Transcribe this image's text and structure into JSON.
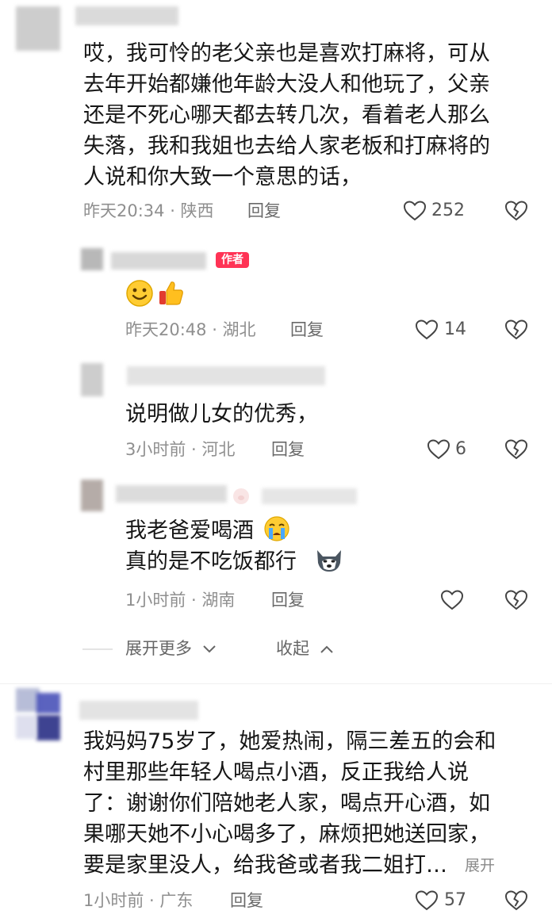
{
  "comments": [
    {
      "text_lines": [
        "哎，我可怜的老父亲也是喜欢打麻将，可从",
        "去年开始都嫌他年龄大没人和他玩了，父亲",
        "还是不死心哪天都去转几次，看着老人那么",
        "失落，我和我姐也去给人家老板和打麻将的",
        "人说和你大致一个意思的话，"
      ],
      "meta": "昨天20:34 · 陕西",
      "reply_label": "回复",
      "likes": "252"
    },
    {
      "author_badge": "作者",
      "emoji": [
        "smiley-emoji",
        "thumbs-up-emoji"
      ],
      "meta": "昨天20:48 · 湖北",
      "reply_label": "回复",
      "likes": "14"
    },
    {
      "text_lines": [
        "说明做儿女的优秀，"
      ],
      "meta": "3小时前 · 河北",
      "reply_label": "回复",
      "likes": "6"
    },
    {
      "text_lines": [
        "我老爸爱喝酒",
        "真的是不吃饭都行"
      ],
      "emoji": [
        "crying-emoji",
        "husky-emoji"
      ],
      "meta": "1小时前 · 湖南",
      "reply_label": "回复",
      "likes": ""
    },
    {
      "text_lines": [
        "我妈妈75岁了，她爱热闹，隔三差五的会和",
        "村里那些年轻人喝点小酒，反正我给人说",
        "了：谢谢你们陪她老人家，喝点开心酒，如",
        "果哪天她不小心喝多了，麻烦把她送回家，",
        "要是家里没人，给我爸或者我二姐打…"
      ],
      "more_label": "展开",
      "meta": "1小时前 · 广东",
      "reply_label": "回复",
      "likes": "57"
    }
  ],
  "thread_controls": {
    "expand_more": "展开更多",
    "collapse": "收起"
  }
}
